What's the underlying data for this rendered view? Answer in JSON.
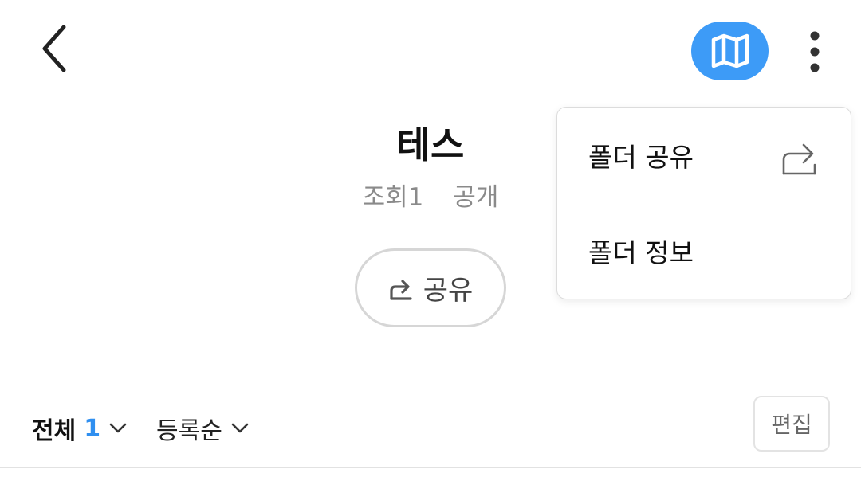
{
  "header": {
    "back_icon": "chevron-left-icon",
    "map_icon": "map-icon",
    "more_icon": "more-vertical-icon",
    "accent_color": "#3d9bf7"
  },
  "folder": {
    "title": "테스",
    "views": "조회1",
    "visibility": "공개",
    "share_label": "공유"
  },
  "toolbar": {
    "filter_label": "전체",
    "filter_count": "1",
    "sort_label": "등록순",
    "edit_label": "편집"
  },
  "menu": {
    "items": [
      {
        "label": "폴더 공유",
        "icon": "share-icon"
      },
      {
        "label": "폴더 정보"
      }
    ]
  }
}
